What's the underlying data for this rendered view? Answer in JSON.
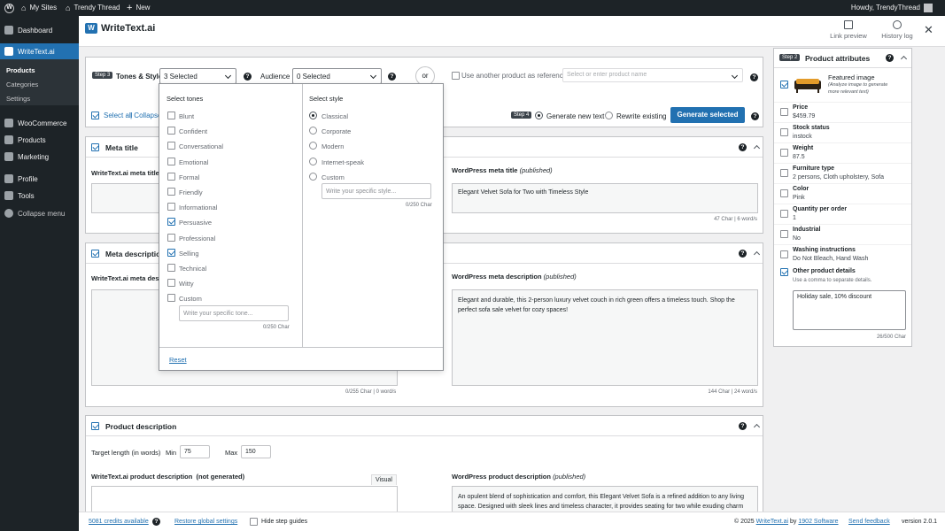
{
  "adminbar": {
    "my_sites": "My Sites",
    "site": "Trendy Thread",
    "new": "New",
    "howdy": "Howdy, TrendyThread"
  },
  "sidebar": {
    "dashboard": "Dashboard",
    "writetext": "WriteText.ai",
    "sub_products": "Products",
    "sub_categories": "Categories",
    "sub_settings": "Settings",
    "woocommerce": "WooCommerce",
    "products": "Products",
    "marketing": "Marketing",
    "profile": "Profile",
    "tools": "Tools",
    "collapse": "Collapse menu"
  },
  "header": {
    "logo": "WriteText.ai",
    "link_preview": "Link preview",
    "history_log": "History log"
  },
  "toolbar": {
    "step3": "Step 3",
    "tones_style": "Tones & Style",
    "tones_value": "3 Selected",
    "audience": "Audience",
    "audience_value": "0 Selected",
    "or": "or",
    "use_another": "Use another product as reference",
    "product_placeholder": "Select or enter product name",
    "select_all": "Select all",
    "collapse_partial": "| Collapse",
    "step4": "Step 4",
    "generate_new": "Generate new text",
    "rewrite_existing": "Rewrite existing",
    "generate_selected": "Generate selected"
  },
  "dropdown": {
    "tones_title": "Select tones",
    "tones": [
      {
        "label": "Blunt",
        "checked": false
      },
      {
        "label": "Confident",
        "checked": false
      },
      {
        "label": "Conversational",
        "checked": false
      },
      {
        "label": "Emotional",
        "checked": false
      },
      {
        "label": "Formal",
        "checked": false
      },
      {
        "label": "Friendly",
        "checked": false
      },
      {
        "label": "Informational",
        "checked": false
      },
      {
        "label": "Persuasive",
        "checked": true
      },
      {
        "label": "Professional",
        "checked": false
      },
      {
        "label": "Selling",
        "checked": true
      },
      {
        "label": "Technical",
        "checked": false
      },
      {
        "label": "Witty",
        "checked": false
      },
      {
        "label": "Custom",
        "checked": false
      }
    ],
    "tone_placeholder": "Write your specific tone...",
    "tone_count": "0/250 Char",
    "style_title": "Select style",
    "styles": [
      {
        "label": "Classical",
        "checked": true
      },
      {
        "label": "Corporate",
        "checked": false
      },
      {
        "label": "Modern",
        "checked": false
      },
      {
        "label": "Internet-speak",
        "checked": false
      },
      {
        "label": "Custom",
        "checked": false
      }
    ],
    "style_placeholder": "Write your specific style...",
    "style_count": "0/250 Char",
    "reset": "Reset"
  },
  "meta_title": {
    "title": "Meta title",
    "wta_label": "WriteText.ai meta title",
    "wp_label": "WordPress meta title",
    "wp_status": "(published)",
    "wp_value": "Elegant Velvet Sofa for Two with Timeless Style",
    "wp_count": "47 Char | 6 word/s"
  },
  "meta_desc": {
    "title": "Meta description",
    "wta_label": "WriteText.ai meta descr",
    "wta_count": "0/255 Char | 0 word/s",
    "wp_label": "WordPress meta description",
    "wp_status": "(published)",
    "wp_line1": "Elegant and durable, this 2-person luxury velvet couch in rich green offers a timeless touch. Shop the",
    "wp_line2": "perfect sofa sale velvet for cozy spaces!",
    "wp_count": "144 Char | 24 word/s"
  },
  "product_desc": {
    "title": "Product description",
    "target": "Target length (in words)",
    "min_label": "Min",
    "min_value": "75",
    "max_label": "Max",
    "max_value": "150",
    "wta_label": "WriteText.ai product description",
    "wta_status": "(not generated)",
    "visual": "Visual",
    "wp_label": "WordPress product description",
    "wp_status": "(published)",
    "wp_line1": "An opulent blend of sophistication and comfort, this Elegant Velvet Sofa is a refined addition to any living",
    "wp_line2": "space. Designed with sleek lines and timeless character, it provides seating for two while exuding charm"
  },
  "attributes": {
    "step2": "Step 2",
    "title": "Product attributes",
    "featured_label": "Featured image",
    "featured_note1": "(Analyze image to generate",
    "featured_note2": "more relevant text)",
    "items": [
      {
        "label": "Price",
        "value": "$459.79",
        "checked": false
      },
      {
        "label": "Stock status",
        "value": "instock",
        "checked": false
      },
      {
        "label": "Weight",
        "value": "87.5",
        "checked": false
      },
      {
        "label": "Furniture type",
        "value": "2 persons, Cloth upholstery, Sofa",
        "checked": false
      },
      {
        "label": "Color",
        "value": "Pink",
        "checked": false
      },
      {
        "label": "Quantity per order",
        "value": "1",
        "checked": false
      },
      {
        "label": "Industrial",
        "value": "No",
        "checked": false
      },
      {
        "label": "Washing instructions",
        "value": "Do Not Bleach, Hand Wash",
        "checked": false
      }
    ],
    "other_label": "Other product details",
    "other_note": "Use a comma to separate details.",
    "other_value": "Holiday sale, 10% discount",
    "other_count": "26/500 Char"
  },
  "footer": {
    "credits": "5081 credits available",
    "restore": "Restore global settings",
    "hide_guides": "Hide step guides",
    "copyright": "© 2025",
    "wta_link": "WriteText.ai",
    "by": "by",
    "company": "1902 Software",
    "feedback": "Send feedback",
    "version": "version 2.0.1"
  }
}
